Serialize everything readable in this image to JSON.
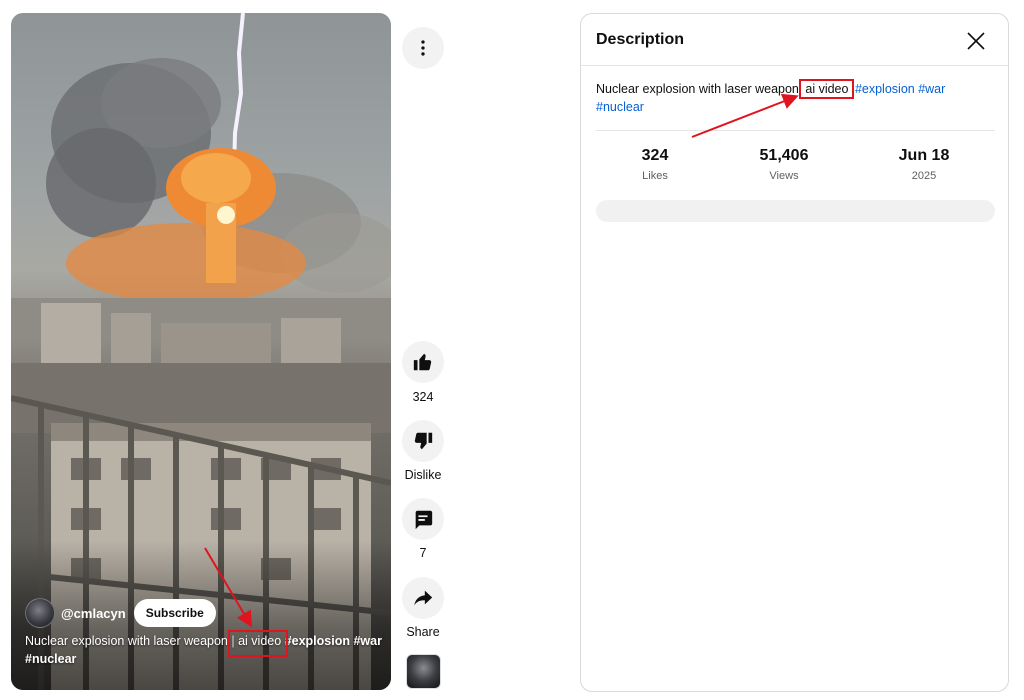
{
  "video": {
    "channel_handle": "@cmlacyn",
    "subscribe_label": "Subscribe",
    "desc_main": "Nuclear explosion with laser weapon",
    "desc_separator": "|",
    "desc_highlight": "ai video",
    "tag_1": "#explosion",
    "tag_2": "#war",
    "tag_3": "#nuclear"
  },
  "actions": {
    "like_count": "324",
    "dislike_label": "Dislike",
    "comment_count": "7",
    "share_label": "Share"
  },
  "panel": {
    "title": "Description",
    "desc_main": "Nuclear explosion with laser weapon",
    "desc_highlight": "ai video",
    "tag_1": "#explosion",
    "tag_2": "#war",
    "tag_3": "#nuclear",
    "stats": [
      {
        "value": "324",
        "label": "Likes"
      },
      {
        "value": "51,406",
        "label": "Views"
      },
      {
        "value": "Jun 18",
        "label": "2025"
      }
    ]
  },
  "icons": [
    "more-vert-icon",
    "thumb-up-icon",
    "thumb-down-icon",
    "comment-icon",
    "share-icon",
    "close-icon"
  ],
  "colors": {
    "annotation": "#e0131e",
    "link": "#065fd4",
    "fireball": "#f39a3c"
  }
}
